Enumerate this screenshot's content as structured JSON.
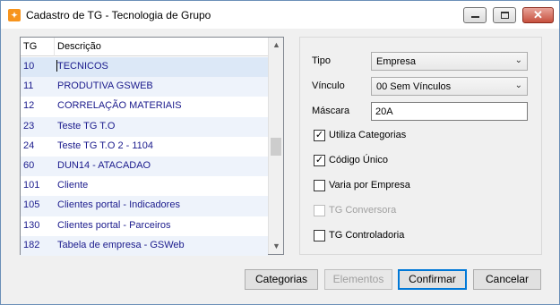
{
  "window": {
    "title": "Cadastro de TG - Tecnologia de Grupo",
    "icon": "app-logo-icon",
    "controls": {
      "minimize": "minimize-icon",
      "maximize": "maximize-icon",
      "close": "close-icon"
    }
  },
  "grid": {
    "columns": {
      "tg": "TG",
      "descricao": "Descrição"
    },
    "rows": [
      {
        "tg": "10",
        "descricao": "TECNICOS",
        "selected": true
      },
      {
        "tg": "11",
        "descricao": "PRODUTIVA GSWEB"
      },
      {
        "tg": "12",
        "descricao": "CORRELAÇÃO MATERIAIS"
      },
      {
        "tg": "23",
        "descricao": "Teste TG T.O"
      },
      {
        "tg": "24",
        "descricao": "Teste TG T.O 2 - 1104"
      },
      {
        "tg": "60",
        "descricao": "DUN14 - ATACADAO"
      },
      {
        "tg": "101",
        "descricao": "Cliente"
      },
      {
        "tg": "105",
        "descricao": "Clientes portal - Indicadores"
      },
      {
        "tg": "130",
        "descricao": "Clientes portal - Parceiros"
      },
      {
        "tg": "182",
        "descricao": "Tabela de empresa - GSWeb"
      }
    ]
  },
  "form": {
    "tipo": {
      "label": "Tipo",
      "value": "Empresa"
    },
    "vinculo": {
      "label": "Vínculo",
      "value": "00 Sem Vínculos"
    },
    "mascara": {
      "label": "Máscara",
      "value": "20A"
    },
    "checks": {
      "utiliza_categorias": {
        "label": "Utiliza Categorias",
        "checked": true
      },
      "codigo_unico": {
        "label": "Código Único",
        "checked": true
      },
      "varia_por_empresa": {
        "label": "Varia por Empresa",
        "checked": false
      },
      "tg_conversora": {
        "label": "TG Conversora",
        "checked": false,
        "disabled": true
      },
      "tg_controladoria": {
        "label": "TG Controladoria",
        "checked": false
      }
    }
  },
  "buttons": {
    "categorias": "Categorias",
    "elementos": "Elementos",
    "confirmar": "Confirmar",
    "cancelar": "Cancelar"
  },
  "colors": {
    "row_text": "#1a1a8c",
    "accent": "#0078d7"
  }
}
